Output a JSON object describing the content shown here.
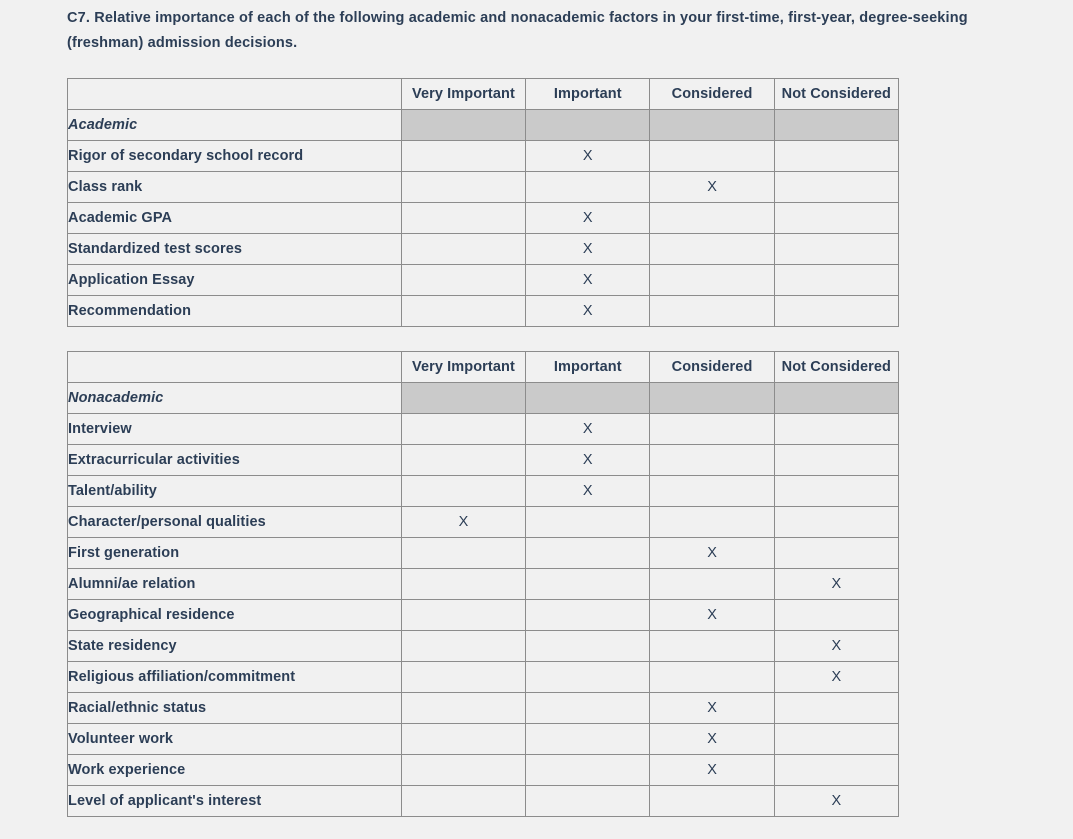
{
  "prompt": "C7. Relative importance of each of the following academic and nonacademic factors in your first-time, first-year, degree-seeking (freshman) admission decisions.",
  "colors": {
    "page_background": "#f1f1f1",
    "text": "#2c3e56",
    "border": "#8c8c8c",
    "section_row_shading": "#cacaca"
  },
  "mark_symbol": "X",
  "columns": [
    "",
    "Very Important",
    "Important",
    "Considered",
    "Not Considered"
  ],
  "tables": [
    {
      "id": "academic",
      "headers": [
        "",
        "Very Important",
        "Important",
        "Considered",
        "Not Considered"
      ],
      "section_label": "Academic",
      "rows": [
        {
          "label": "Rigor of secondary school record",
          "rating": "Important"
        },
        {
          "label": "Class rank",
          "rating": "Considered"
        },
        {
          "label": "Academic GPA",
          "rating": "Important"
        },
        {
          "label": "Standardized test scores",
          "rating": "Important"
        },
        {
          "label": "Application Essay",
          "rating": "Important"
        },
        {
          "label": "Recommendation",
          "rating": "Important"
        }
      ]
    },
    {
      "id": "nonacademic",
      "headers": [
        "",
        "Very Important",
        "Important",
        "Considered",
        "Not Considered"
      ],
      "section_label": "Nonacademic",
      "rows": [
        {
          "label": "Interview",
          "rating": "Important"
        },
        {
          "label": "Extracurricular activities",
          "rating": "Important"
        },
        {
          "label": "Talent/ability",
          "rating": "Important"
        },
        {
          "label": "Character/personal qualities",
          "rating": "Very Important"
        },
        {
          "label": "First generation",
          "rating": "Considered"
        },
        {
          "label": "Alumni/ae relation",
          "rating": "Not Considered"
        },
        {
          "label": "Geographical residence",
          "rating": "Considered"
        },
        {
          "label": "State residency",
          "rating": "Not Considered"
        },
        {
          "label": "Religious affiliation/commitment",
          "rating": "Not Considered"
        },
        {
          "label": "Racial/ethnic status",
          "rating": "Considered"
        },
        {
          "label": "Volunteer work",
          "rating": "Considered"
        },
        {
          "label": "Work experience",
          "rating": "Considered"
        },
        {
          "label": "Level of applicant's interest",
          "rating": "Not Considered"
        }
      ]
    }
  ]
}
